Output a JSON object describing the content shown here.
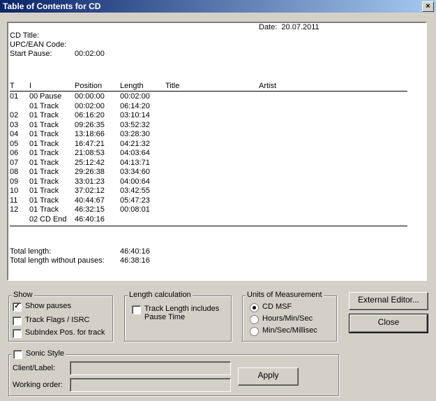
{
  "window": {
    "title": "Table of Contents for CD",
    "close": "×"
  },
  "report": {
    "cd_title_label": "CD Title:",
    "upc_label": "UPC/EAN Code:",
    "start_pause_label": "Start Pause:",
    "start_pause_value": "00:02:00",
    "date": "Date:  20.07.2011",
    "columns": {
      "t": "T",
      "i": "I",
      "position": "Position",
      "length": "Length",
      "title": "Title",
      "artist": "Artist"
    },
    "rows": [
      {
        "t": "01",
        "i": "00",
        "type": "Pause",
        "position": "00:00:00",
        "length": "00:02:00"
      },
      {
        "t": "",
        "i": "01",
        "type": "Track",
        "position": "00:02:00",
        "length": "06:14:20"
      },
      {
        "t": "02",
        "i": "01",
        "type": "Track",
        "position": "06:16:20",
        "length": "03:10:14"
      },
      {
        "t": "03",
        "i": "01",
        "type": "Track",
        "position": "09:26:35",
        "length": "03:52:32"
      },
      {
        "t": "04",
        "i": "01",
        "type": "Track",
        "position": "13:18:66",
        "length": "03:28:30"
      },
      {
        "t": "05",
        "i": "01",
        "type": "Track",
        "position": "16:47:21",
        "length": "04:21:32"
      },
      {
        "t": "06",
        "i": "01",
        "type": "Track",
        "position": "21:08:53",
        "length": "04:03:64"
      },
      {
        "t": "07",
        "i": "01",
        "type": "Track",
        "position": "25:12:42",
        "length": "04:13:71"
      },
      {
        "t": "08",
        "i": "01",
        "type": "Track",
        "position": "29:26:38",
        "length": "03:34:60"
      },
      {
        "t": "09",
        "i": "01",
        "type": "Track",
        "position": "33:01:23",
        "length": "04:00:64"
      },
      {
        "t": "10",
        "i": "01",
        "type": "Track",
        "position": "37:02:12",
        "length": "03:42:55"
      },
      {
        "t": "11",
        "i": "01",
        "type": "Track",
        "position": "40:44:67",
        "length": "05:47:23"
      },
      {
        "t": "12",
        "i": "01",
        "type": "Track",
        "position": "46:32:15",
        "length": "00:08:01"
      },
      {
        "t": "",
        "i": "02",
        "type": "CD End",
        "position": "46:40:16",
        "length": ""
      }
    ],
    "total_length_label": "Total length:",
    "total_length_value": "46:40:16",
    "total_nopause_label": "Total length without pauses:",
    "total_nopause_value": "46:38:16"
  },
  "show": {
    "legend": "Show",
    "show_pauses": {
      "label": "Show pauses",
      "checked": true
    },
    "track_flags": {
      "label": "Track Flags / ISRC",
      "checked": false
    },
    "subindex": {
      "label": "SubIndex Pos. for track",
      "checked": false
    }
  },
  "length_calc": {
    "legend": "Length calculation",
    "includes_pause": {
      "label": "Track Length includes Pause Time",
      "checked": false
    }
  },
  "units": {
    "legend": "Units of Measurement",
    "options": [
      {
        "label": "CD MSF",
        "selected": true
      },
      {
        "label": "Hours/Min/Sec",
        "selected": false
      },
      {
        "label": "Min/Sec/Millisec",
        "selected": false
      }
    ]
  },
  "buttons": {
    "external_editor": "External Editor...",
    "close": "Close",
    "apply": "Apply"
  },
  "sonic": {
    "label": "Sonic Style",
    "checked": false,
    "client_label": "Client/Label:",
    "client_value": "",
    "order_label": "Working order:",
    "order_value": ""
  }
}
